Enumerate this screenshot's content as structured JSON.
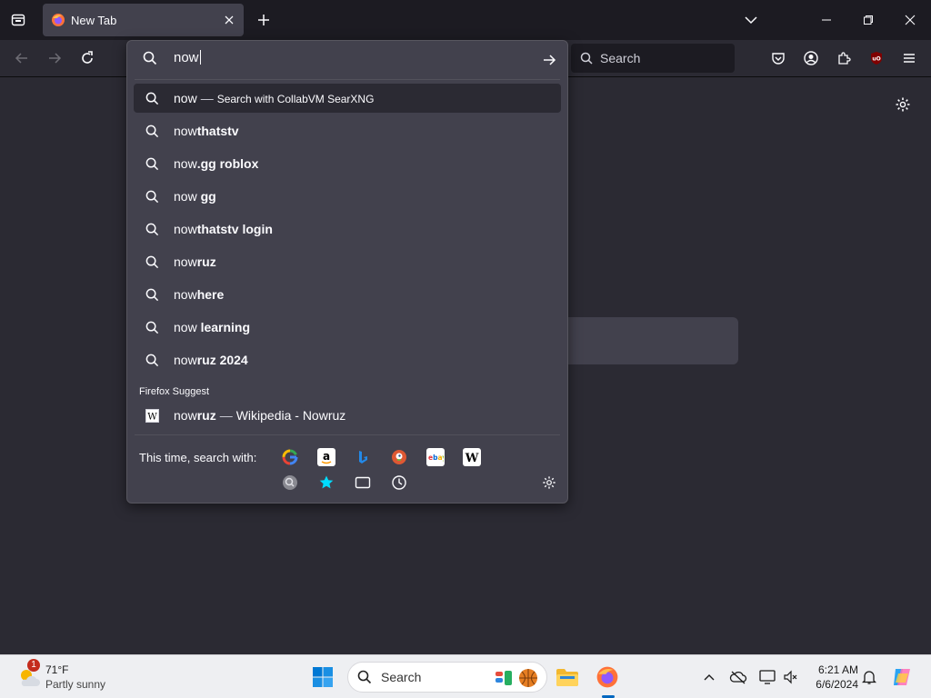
{
  "browser": {
    "tab": {
      "title": "New Tab"
    },
    "search_placeholder": "Search"
  },
  "urlbar": {
    "input_value": "now",
    "heuristic": {
      "query": "now",
      "separator": "—",
      "action": "Search with CollabVM SearXNG"
    },
    "suggestions": [
      {
        "typed": "now",
        "completion": "thatstv"
      },
      {
        "typed": "now",
        "completion": ".gg roblox"
      },
      {
        "typed": "now ",
        "completion": "gg"
      },
      {
        "typed": "now",
        "completion": "thatstv login"
      },
      {
        "typed": "now",
        "completion": "ruz"
      },
      {
        "typed": "now",
        "completion": "here"
      },
      {
        "typed": "now ",
        "completion": "learning"
      },
      {
        "typed": "now",
        "completion": "ruz 2024"
      }
    ],
    "firefox_suggest_label": "Firefox Suggest",
    "firefox_suggest_item": {
      "typed": "now",
      "completion": "ruz",
      "separator": "—",
      "title": "Wikipedia - Nowruz"
    },
    "search_with_label": "This time, search with:",
    "engines": [
      "google-icon",
      "amazon-icon",
      "bing-icon",
      "duckduckgo-icon",
      "ebay-icon",
      "wikipedia-icon"
    ],
    "modes": [
      "searxng-icon",
      "bookmarks-star-icon",
      "tabs-icon",
      "history-clock-icon"
    ]
  },
  "taskbar": {
    "weather": {
      "temp": "71°F",
      "condition": "Partly sunny",
      "badge": "1"
    },
    "search_label": "Search",
    "clock": {
      "time": "6:21 AM",
      "date": "6/6/2024"
    }
  },
  "colors": {
    "toolbar_bg": "#2b2a33",
    "tabstrip_bg": "#1c1b22",
    "popup_bg": "#42414d",
    "taskbar_bg": "#eeeff2",
    "accent": "#0067c0"
  }
}
